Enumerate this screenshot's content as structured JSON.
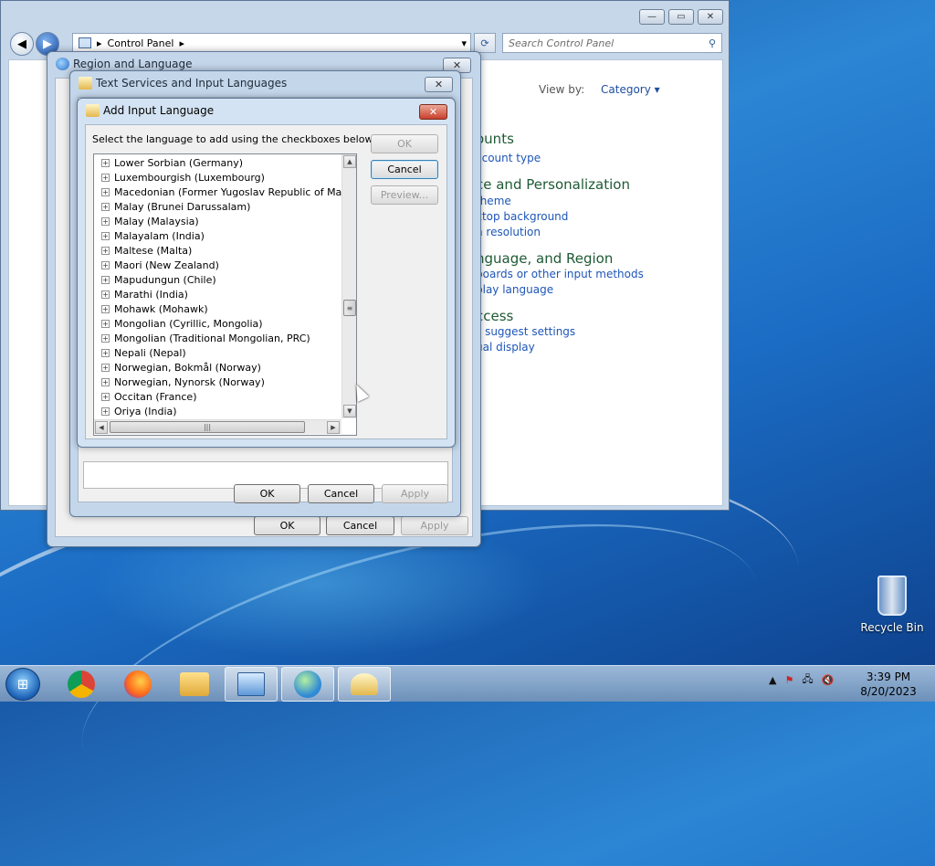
{
  "control_panel": {
    "breadcrumb": "Control Panel",
    "search_placeholder": "Search Control Panel",
    "view_by_label": "View by:",
    "view_by_value": "Category",
    "categories": [
      {
        "heading": "ounts",
        "links": [
          "ccount type"
        ]
      },
      {
        "heading": "ce and Personalization",
        "links": [
          "theme",
          "ktop background",
          "n resolution"
        ]
      },
      {
        "heading": "nguage, and Region",
        "links": [
          "boards or other input methods",
          "play language"
        ]
      },
      {
        "heading": "ccess",
        "links": [
          "s suggest settings",
          "ual display"
        ]
      }
    ]
  },
  "region_dialog": {
    "title": "Region and Language",
    "close": "✕",
    "ok": "OK",
    "cancel": "Cancel",
    "apply": "Apply"
  },
  "text_services_dialog": {
    "title": "Text Services and Input Languages",
    "close": "✕",
    "ok": "OK",
    "cancel": "Cancel",
    "apply": "Apply"
  },
  "add_language_dialog": {
    "title": "Add Input Language",
    "close": "✕",
    "instruction": "Select the language to add using the checkboxes below.",
    "ok": "OK",
    "cancel": "Cancel",
    "preview": "Preview...",
    "languages": [
      "Lower Sorbian (Germany)",
      "Luxembourgish (Luxembourg)",
      "Macedonian (Former Yugoslav Republic of Macedon",
      "Malay (Brunei Darussalam)",
      "Malay (Malaysia)",
      "Malayalam (India)",
      "Maltese (Malta)",
      "Maori (New Zealand)",
      "Mapudungun (Chile)",
      "Marathi (India)",
      "Mohawk (Mohawk)",
      "Mongolian (Cyrillic, Mongolia)",
      "Mongolian (Traditional Mongolian, PRC)",
      "Nepali (Nepal)",
      "Norwegian, Bokmål (Norway)",
      "Norwegian, Nynorsk (Norway)",
      "Occitan (France)",
      "Oriya (India)"
    ]
  },
  "desktop": {
    "recycle_bin": "Recycle Bin"
  },
  "taskbar": {
    "apps": [
      "start",
      "chrome-icon",
      "firefox-icon",
      "file-explorer-icon",
      "control-panel-icon",
      "region-language-icon",
      "text-services-icon"
    ],
    "time": "3:39 PM",
    "date": "8/20/2023"
  },
  "colors": {
    "link_blue": "#1e56b8",
    "category_green": "#1e5a35",
    "dialog_frame": "#c4d6ea"
  }
}
